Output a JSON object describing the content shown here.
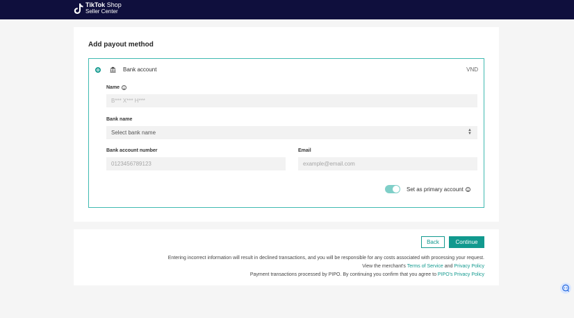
{
  "header": {
    "logo_brand": "TikTok",
    "logo_shop": "Shop",
    "logo_sub": "Seller Center"
  },
  "form": {
    "title": "Add payout method",
    "method_label": "Bank account",
    "currency": "VND",
    "name_label": "Name",
    "name_value": "B*** X*** H***",
    "bank_name_label": "Bank name",
    "bank_name_placeholder": "Select bank name",
    "account_number_label": "Bank account number",
    "account_number_placeholder": "0123456789123",
    "email_label": "Email",
    "email_placeholder": "example@email.com",
    "primary_label": "Set as primary account",
    "primary_enabled": true
  },
  "footer": {
    "back_label": "Back",
    "continue_label": "Continue",
    "warning": "Entering incorrect information will result in declined transactions, and you will be responsible for any costs associated with processing your request.",
    "view_prefix": "View the merchant's",
    "terms_link": "Terms of Service",
    "and_text": "and",
    "privacy_link": "Privacy Policy",
    "pipo_text": "Payment transactions processed by PIPO. By continuing you confirm that you agree to",
    "pipo_link": "PIPO's Privacy Policy"
  },
  "colors": {
    "accent": "#11998e",
    "header_bg": "#0f0f3d",
    "field_bg": "#f2f2f2"
  },
  "icons": [
    "tiktok-logo-icon",
    "bank-icon",
    "info-icon",
    "chevron-updown-icon",
    "chat-support-icon"
  ]
}
